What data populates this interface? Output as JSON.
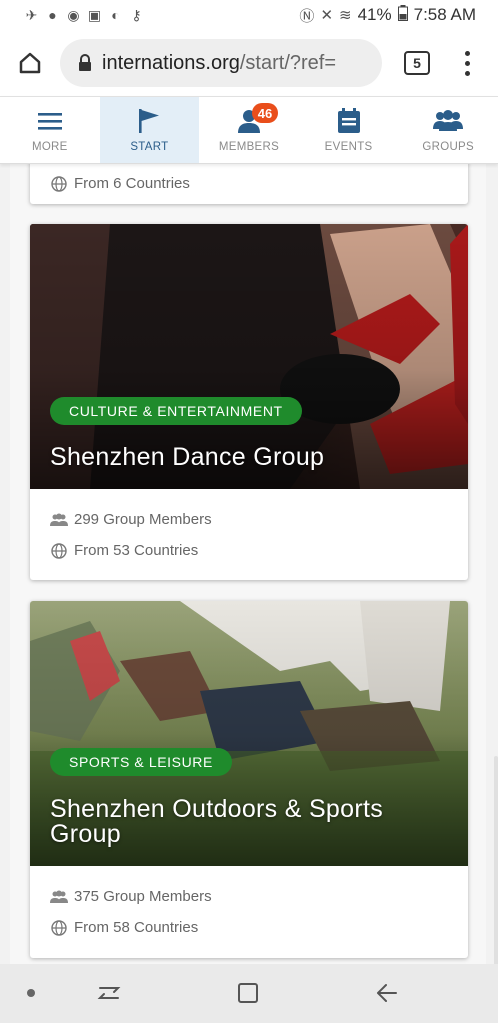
{
  "status_bar": {
    "battery": "41%",
    "time": "7:58 AM"
  },
  "browser": {
    "url_domain": "internations.org",
    "url_path": "/start/?ref=",
    "tab_count": "5"
  },
  "app_nav": {
    "items": [
      {
        "label": "MORE",
        "icon": "hamburger-icon"
      },
      {
        "label": "START",
        "icon": "flag-icon",
        "active": true
      },
      {
        "label": "MEMBERS",
        "icon": "members-icon",
        "badge": "46"
      },
      {
        "label": "EVENTS",
        "icon": "calendar-icon"
      },
      {
        "label": "GROUPS",
        "icon": "groups-icon"
      }
    ],
    "active_color": "#2b5d8a",
    "badge_color": "#e94e1b"
  },
  "groups": {
    "partial_card": {
      "countries": "From 6 Countries"
    },
    "cards": [
      {
        "category": "CULTURE & ENTERTAINMENT",
        "title": "Shenzhen Dance Group",
        "members": "299 Group Members",
        "countries": "From 53 Countries"
      },
      {
        "category": "SPORTS & LEISURE",
        "title": "Shenzhen Outdoors & Sports Group",
        "members": "375 Group Members",
        "countries": "From 58 Countries"
      }
    ],
    "category_color": "#1f8b2c"
  }
}
